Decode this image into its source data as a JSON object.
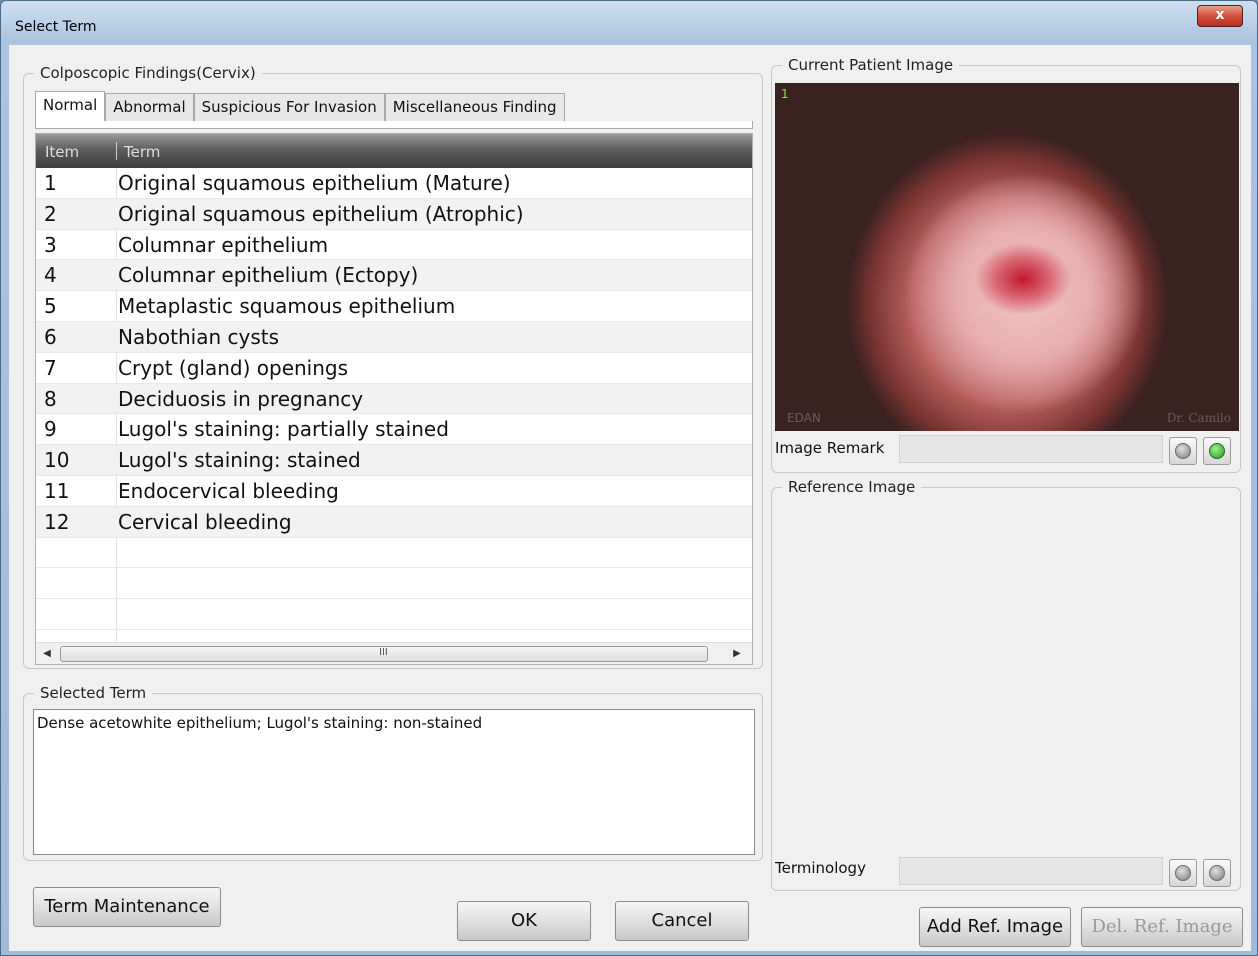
{
  "window": {
    "title": "Select Term",
    "close_label": "x"
  },
  "findings": {
    "legend": "Colposcopic Findings(Cervix)",
    "tabs": [
      "Normal",
      "Abnormal",
      "Suspicious For Invasion",
      "Miscellaneous Finding"
    ],
    "active_tab": "Normal",
    "columns": {
      "item": "Item",
      "term": "Term"
    },
    "rows": [
      {
        "item": "1",
        "term": "Original squamous epithelium (Mature)"
      },
      {
        "item": "2",
        "term": "Original squamous epithelium (Atrophic)"
      },
      {
        "item": "3",
        "term": "Columnar epithelium"
      },
      {
        "item": "4",
        "term": "Columnar epithelium (Ectopy)"
      },
      {
        "item": "5",
        "term": "Metaplastic squamous epithelium"
      },
      {
        "item": "6",
        "term": "Nabothian cysts"
      },
      {
        "item": "7",
        "term": "Crypt (gland) openings"
      },
      {
        "item": "8",
        "term": "Deciduosis in pregnancy"
      },
      {
        "item": "9",
        "term": "Lugol's staining: partially stained"
      },
      {
        "item": "10",
        "term": "Lugol's staining: stained"
      },
      {
        "item": "11",
        "term": "Endocervical bleeding"
      },
      {
        "item": "12",
        "term": "Cervical bleeding"
      }
    ],
    "scroll_grip": "III"
  },
  "selected_term": {
    "legend": "Selected Term",
    "value": "Dense acetowhite epithelium; Lugol's staining: non-stained"
  },
  "current_image": {
    "legend": "Current Patient Image",
    "index": "1",
    "watermark_left": "EDAN",
    "watermark_right": "Dr. Camilo",
    "remark_label": "Image Remark",
    "remark_value": ""
  },
  "reference_image": {
    "legend": "Reference Image",
    "terminology_label": "Terminology",
    "terminology_value": ""
  },
  "buttons": {
    "term_maintenance": "Term Maintenance",
    "ok": "OK",
    "cancel": "Cancel",
    "add_ref_image": "Add Ref. Image",
    "del_ref_image": "Del. Ref. Image"
  },
  "icons": {
    "prev": "prev-arrow-icon",
    "next": "next-arrow-icon",
    "next_active_color": "#2aa52a"
  }
}
